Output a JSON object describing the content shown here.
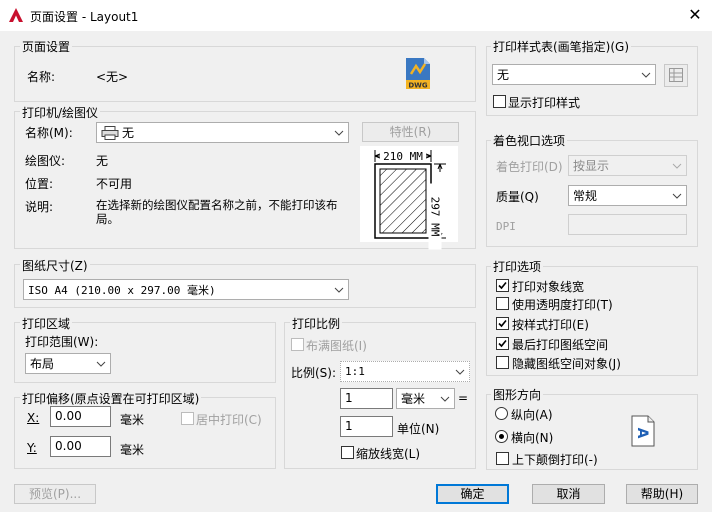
{
  "window": {
    "title": "页面设置 - Layout1",
    "close": "✕"
  },
  "page_setup": {
    "group": "页面设置",
    "name_label": "名称:",
    "name_value": "<无>",
    "dwg_text": "DWG"
  },
  "printer": {
    "group": "打印机/绘图仪",
    "name_label": "名称(M):",
    "name_value": "无",
    "properties_button": "特性(R)",
    "plotter_label": "绘图仪:",
    "plotter_value": "无",
    "location_label": "位置:",
    "location_value": "不可用",
    "description_label": "说明:",
    "description_value_line1": "在选择新的绘图仪配置名称之前，不能打印该布",
    "description_value_line2": "局。",
    "paper_width": "210 MM",
    "paper_height": "297 MM"
  },
  "paper_size": {
    "group": "图纸尺寸(Z)",
    "value": "ISO A4 (210.00 x 297.00 毫米)"
  },
  "plot_area": {
    "group": "打印区域",
    "range_label": "打印范围(W):",
    "range_value": "布局"
  },
  "plot_offset": {
    "group": "打印偏移(原点设置在可打印区域)",
    "x_label": "X:",
    "x_value": "0.00",
    "x_unit": "毫米",
    "y_label": "Y:",
    "y_value": "0.00",
    "y_unit": "毫米",
    "center_label": "居中打印(C)"
  },
  "plot_scale": {
    "group": "打印比例",
    "fit_label": "布满图纸(I)",
    "scale_label": "比例(S):",
    "scale_value": "1:1",
    "num_value": "1",
    "unit_value": "毫米",
    "equals": "=",
    "den_value": "1",
    "den_unit_label": "单位(N)",
    "scale_lw_label": "缩放线宽(L)"
  },
  "plot_style": {
    "group": "打印样式表(画笔指定)(G)",
    "value": "无",
    "display_label": "显示打印样式"
  },
  "shaded_viewport": {
    "group": "着色视口选项",
    "shade_label": "着色打印(D)",
    "shade_value": "按显示",
    "quality_label": "质量(Q)",
    "quality_value": "常规",
    "dpi_label": "DPI"
  },
  "plot_options": {
    "group": "打印选项",
    "items": [
      {
        "label": "打印对象线宽",
        "checked": true
      },
      {
        "label": "使用透明度打印(T)",
        "checked": false
      },
      {
        "label": "按样式打印(E)",
        "checked": true
      },
      {
        "label": "最后打印图纸空间",
        "checked": true
      },
      {
        "label": "隐藏图纸空间对象(J)",
        "checked": false
      }
    ]
  },
  "orientation": {
    "group": "图形方向",
    "portrait_label": "纵向(A)",
    "landscape_label": "横向(N)",
    "upside_label": "上下颠倒打印(-)",
    "icon_letter": "A"
  },
  "footer": {
    "preview": "预览(P)...",
    "ok": "确定",
    "cancel": "取消",
    "help": "帮助(H)"
  },
  "colors": {
    "accent": "#0078d7",
    "autocad_red": "#c8102e"
  }
}
